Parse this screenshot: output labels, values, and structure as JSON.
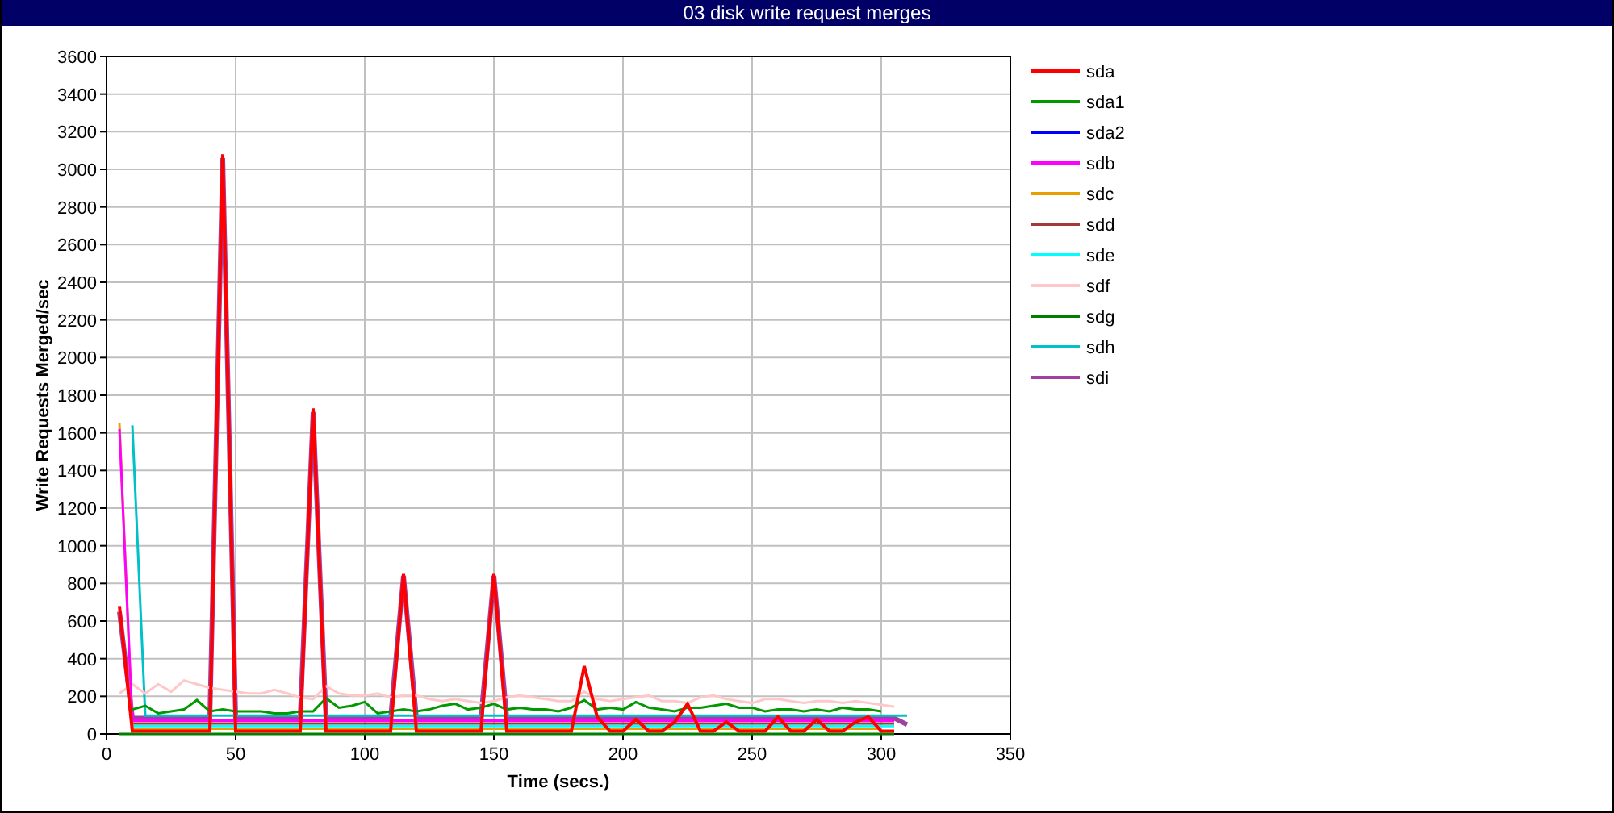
{
  "chart_data": {
    "type": "line",
    "title": "03 disk write request merges",
    "xlabel": "Time (secs.)",
    "ylabel": "Write Requests Merged/sec",
    "grid": true,
    "legend": true,
    "x": [
      5,
      10,
      15,
      20,
      25,
      30,
      35,
      40,
      45,
      50,
      55,
      60,
      65,
      70,
      75,
      80,
      85,
      90,
      95,
      100,
      105,
      110,
      115,
      120,
      125,
      130,
      135,
      140,
      145,
      150,
      155,
      160,
      165,
      170,
      175,
      180,
      185,
      190,
      195,
      200,
      205,
      210,
      215,
      220,
      225,
      230,
      235,
      240,
      245,
      250,
      255,
      260,
      265,
      270,
      275,
      280,
      285,
      290,
      295,
      300,
      305,
      310
    ],
    "xlim": [
      0,
      350
    ],
    "ylim": [
      0,
      3600
    ],
    "xticks": [
      0,
      50,
      100,
      150,
      200,
      250,
      300,
      350
    ],
    "yticks": [
      0,
      200,
      400,
      600,
      800,
      1000,
      1200,
      1400,
      1600,
      1800,
      2000,
      2200,
      2400,
      2600,
      2800,
      3000,
      3200,
      3400,
      3600
    ],
    "series": [
      {
        "name": "sda",
        "color": "#ff0000",
        "values": [
          680,
          15,
          15,
          15,
          15,
          15,
          15,
          15,
          3080,
          15,
          15,
          15,
          15,
          15,
          15,
          1730,
          15,
          15,
          15,
          15,
          15,
          15,
          850,
          15,
          15,
          15,
          15,
          15,
          15,
          850,
          15,
          15,
          15,
          15,
          15,
          15,
          360,
          91,
          15,
          15,
          77,
          15,
          15,
          63,
          160,
          15,
          15,
          63,
          15,
          15,
          15,
          91,
          15,
          15,
          77,
          15,
          15,
          63,
          91,
          15,
          15,
          null
        ]
      },
      {
        "name": "sda1",
        "color": "#009900",
        "values": [
          null,
          130,
          150,
          110,
          120,
          130,
          180,
          120,
          130,
          120,
          120,
          120,
          110,
          110,
          120,
          120,
          190,
          140,
          150,
          170,
          110,
          120,
          130,
          120,
          130,
          150,
          160,
          130,
          140,
          160,
          130,
          140,
          130,
          130,
          120,
          140,
          180,
          130,
          140,
          130,
          170,
          140,
          130,
          120,
          140,
          140,
          150,
          160,
          140,
          140,
          120,
          130,
          130,
          120,
          130,
          120,
          140,
          130,
          130,
          120,
          null,
          null
        ]
      },
      {
        "name": "sda2",
        "color": "#0000ff",
        "values": [
          null,
          null,
          null,
          null,
          null,
          null,
          null,
          null,
          null,
          null,
          null,
          null,
          null,
          null,
          null,
          null,
          null,
          null,
          null,
          null,
          null,
          null,
          null,
          null,
          null,
          null,
          null,
          null,
          null,
          null,
          null,
          null,
          null,
          null,
          null,
          null,
          null,
          null,
          null,
          null,
          null,
          null,
          null,
          null,
          null,
          null,
          null,
          null,
          null,
          null,
          null,
          null,
          null,
          null,
          null,
          null,
          null,
          null,
          null,
          null,
          null,
          null
        ]
      },
      {
        "name": "sdb",
        "color": "#ff00ff",
        "values": [
          1620,
          70,
          70,
          70,
          70,
          70,
          70,
          70,
          70,
          70,
          70,
          70,
          70,
          70,
          70,
          70,
          70,
          70,
          70,
          70,
          70,
          70,
          70,
          70,
          70,
          70,
          70,
          70,
          70,
          70,
          70,
          70,
          70,
          70,
          70,
          70,
          70,
          70,
          70,
          70,
          70,
          70,
          70,
          70,
          70,
          70,
          70,
          70,
          70,
          70,
          70,
          70,
          70,
          70,
          70,
          70,
          70,
          70,
          70,
          70,
          70,
          null
        ]
      },
      {
        "name": "sdc",
        "color": "#e8a000",
        "values": [
          1650,
          28,
          28,
          28,
          28,
          28,
          28,
          28,
          28,
          28,
          28,
          28,
          28,
          28,
          28,
          28,
          28,
          28,
          28,
          28,
          28,
          28,
          28,
          28,
          28,
          28,
          28,
          28,
          28,
          28,
          28,
          28,
          28,
          28,
          28,
          28,
          28,
          28,
          28,
          28,
          28,
          28,
          28,
          28,
          28,
          28,
          28,
          28,
          28,
          28,
          28,
          28,
          28,
          28,
          28,
          28,
          28,
          28,
          28,
          28,
          null,
          null
        ]
      },
      {
        "name": "sdd",
        "color": "#a33a3a",
        "values": [
          null,
          56,
          56,
          56,
          56,
          56,
          56,
          56,
          56,
          56,
          56,
          56,
          56,
          56,
          56,
          56,
          56,
          56,
          56,
          56,
          56,
          56,
          56,
          56,
          56,
          56,
          56,
          56,
          56,
          56,
          56,
          56,
          56,
          56,
          56,
          56,
          56,
          56,
          56,
          56,
          56,
          56,
          56,
          56,
          56,
          56,
          56,
          56,
          56,
          56,
          56,
          56,
          56,
          56,
          56,
          56,
          56,
          56,
          56,
          56,
          56,
          null
        ]
      },
      {
        "name": "sde",
        "color": "#00ffff",
        "values": [
          null,
          42,
          42,
          42,
          42,
          42,
          42,
          42,
          42,
          42,
          42,
          42,
          42,
          42,
          42,
          42,
          42,
          42,
          42,
          42,
          42,
          42,
          42,
          42,
          42,
          42,
          42,
          42,
          42,
          42,
          42,
          42,
          42,
          42,
          42,
          42,
          42,
          42,
          42,
          42,
          42,
          42,
          42,
          42,
          42,
          42,
          42,
          42,
          42,
          42,
          42,
          42,
          42,
          42,
          42,
          42,
          42,
          42,
          42,
          42,
          42,
          null
        ]
      },
      {
        "name": "sdf",
        "color": "#ffc8c8",
        "values": [
          215,
          265,
          215,
          265,
          225,
          285,
          265,
          245,
          235,
          225,
          215,
          215,
          235,
          215,
          195,
          185,
          255,
          215,
          205,
          205,
          215,
          195,
          205,
          205,
          185,
          175,
          185,
          175,
          165,
          175,
          195,
          205,
          195,
          185,
          175,
          175,
          225,
          185,
          175,
          185,
          195,
          205,
          175,
          175,
          165,
          195,
          205,
          185,
          175,
          165,
          185,
          185,
          175,
          165,
          175,
          175,
          165,
          175,
          165,
          155,
          145,
          null
        ]
      },
      {
        "name": "sdg",
        "color": "#007f00",
        "values": [
          0,
          0,
          0,
          0,
          0,
          0,
          0,
          0,
          0,
          0,
          0,
          0,
          0,
          0,
          0,
          0,
          0,
          0,
          0,
          0,
          0,
          0,
          0,
          0,
          0,
          0,
          0,
          0,
          0,
          0,
          0,
          0,
          0,
          0,
          0,
          0,
          0,
          0,
          0,
          0,
          0,
          0,
          0,
          0,
          0,
          0,
          0,
          0,
          0,
          0,
          0,
          0,
          0,
          0,
          0,
          0,
          0,
          0,
          0,
          0,
          0,
          null
        ]
      },
      {
        "name": "sdh",
        "color": "#00c0c8",
        "values": [
          null,
          1640,
          98,
          98,
          98,
          98,
          98,
          98,
          98,
          98,
          98,
          98,
          98,
          98,
          98,
          98,
          98,
          98,
          98,
          98,
          98,
          98,
          98,
          98,
          98,
          98,
          98,
          98,
          98,
          98,
          98,
          98,
          98,
          98,
          98,
          98,
          98,
          98,
          98,
          98,
          98,
          98,
          98,
          98,
          98,
          98,
          98,
          98,
          98,
          98,
          98,
          98,
          98,
          98,
          98,
          98,
          98,
          98,
          98,
          98,
          98,
          98
        ]
      },
      {
        "name": "sdi",
        "color": "#a040a0",
        "values": [
          650,
          84,
          84,
          84,
          84,
          84,
          84,
          84,
          3060,
          84,
          84,
          84,
          84,
          84,
          84,
          1710,
          84,
          84,
          84,
          84,
          84,
          84,
          840,
          84,
          84,
          84,
          84,
          84,
          84,
          840,
          84,
          84,
          84,
          84,
          84,
          84,
          84,
          84,
          84,
          84,
          84,
          84,
          84,
          84,
          84,
          84,
          84,
          84,
          84,
          84,
          84,
          84,
          84,
          84,
          84,
          84,
          84,
          84,
          84,
          84,
          84,
          50
        ]
      }
    ]
  }
}
